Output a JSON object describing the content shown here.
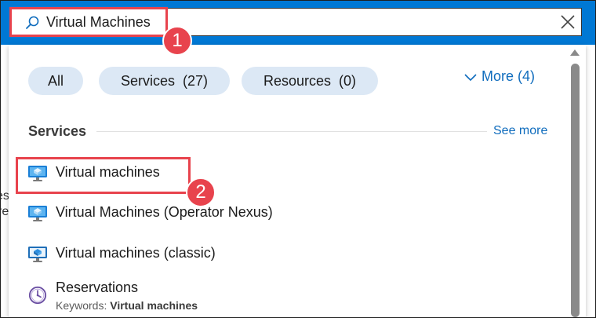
{
  "search": {
    "value": "Virtual Machines",
    "clear_icon": "close-icon",
    "search_icon": "search-icon"
  },
  "callouts": [
    "1",
    "2"
  ],
  "filters": {
    "all_label": "All",
    "services_label": "Services",
    "services_count": "(27)",
    "resources_label": "Resources",
    "resources_count": "(0)",
    "more_label": "More (4)"
  },
  "services": {
    "title": "Services",
    "see_more_label": "See more",
    "items": [
      {
        "label": "Virtual machines",
        "icon": "virtual-machine-icon"
      },
      {
        "label": "Virtual Machines (Operator Nexus)",
        "icon": "virtual-machine-icon"
      },
      {
        "label": "Virtual machines (classic)",
        "icon": "virtual-machine-classic-icon"
      },
      {
        "label": "Reservations",
        "icon": "clock-icon"
      }
    ],
    "keywords_prefix": "Keywords:",
    "keywords_value": "Virtual machines"
  },
  "background_fragments": [
    "es",
    "re"
  ],
  "colors": {
    "topbar": "#0078d4",
    "pill": "#dce8f5",
    "link": "#0f6cbd",
    "callout": "#e8434d"
  }
}
